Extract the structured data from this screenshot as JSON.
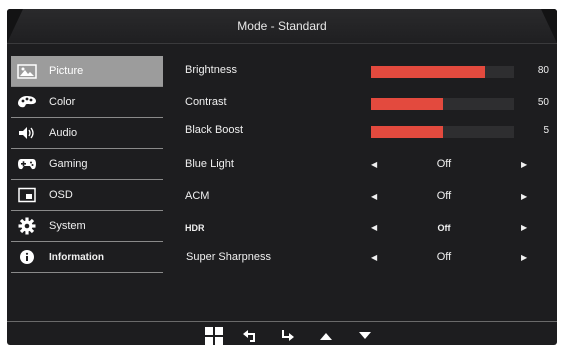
{
  "header": {
    "title": "Mode - Standard"
  },
  "sidebar": {
    "items": [
      {
        "label": "Picture",
        "icon": "picture-icon"
      },
      {
        "label": "Color",
        "icon": "palette-icon"
      },
      {
        "label": "Audio",
        "icon": "speaker-icon"
      },
      {
        "label": "Gaming",
        "icon": "gamepad-icon"
      },
      {
        "label": "OSD",
        "icon": "osd-window-icon"
      },
      {
        "label": "System",
        "icon": "gear-icon"
      },
      {
        "label": "Information",
        "icon": "info-icon"
      }
    ]
  },
  "settings": {
    "brightness": {
      "label": "Brightness",
      "value": "80",
      "level": 0.8
    },
    "contrast": {
      "label": "Contrast",
      "value": "50",
      "level": 0.5
    },
    "black_boost": {
      "label": "Black Boost",
      "value": "5",
      "level": 0.5
    },
    "blue_light": {
      "label": "Blue Light",
      "value": "Off"
    },
    "acm": {
      "label": "ACM",
      "value": "Off"
    },
    "hdr": {
      "label": "HDR",
      "value": "Off"
    },
    "super_sharpness": {
      "label": "Super Sharpness",
      "value": "Off"
    }
  },
  "footer": {
    "buttons": [
      "menu-grid-icon",
      "back-icon",
      "enter-icon",
      "up-arrow-icon",
      "down-arrow-icon"
    ]
  },
  "colors": {
    "accent": "#e34a3e",
    "panel": "#1d1d1f",
    "selected": "#9c9c9c"
  }
}
